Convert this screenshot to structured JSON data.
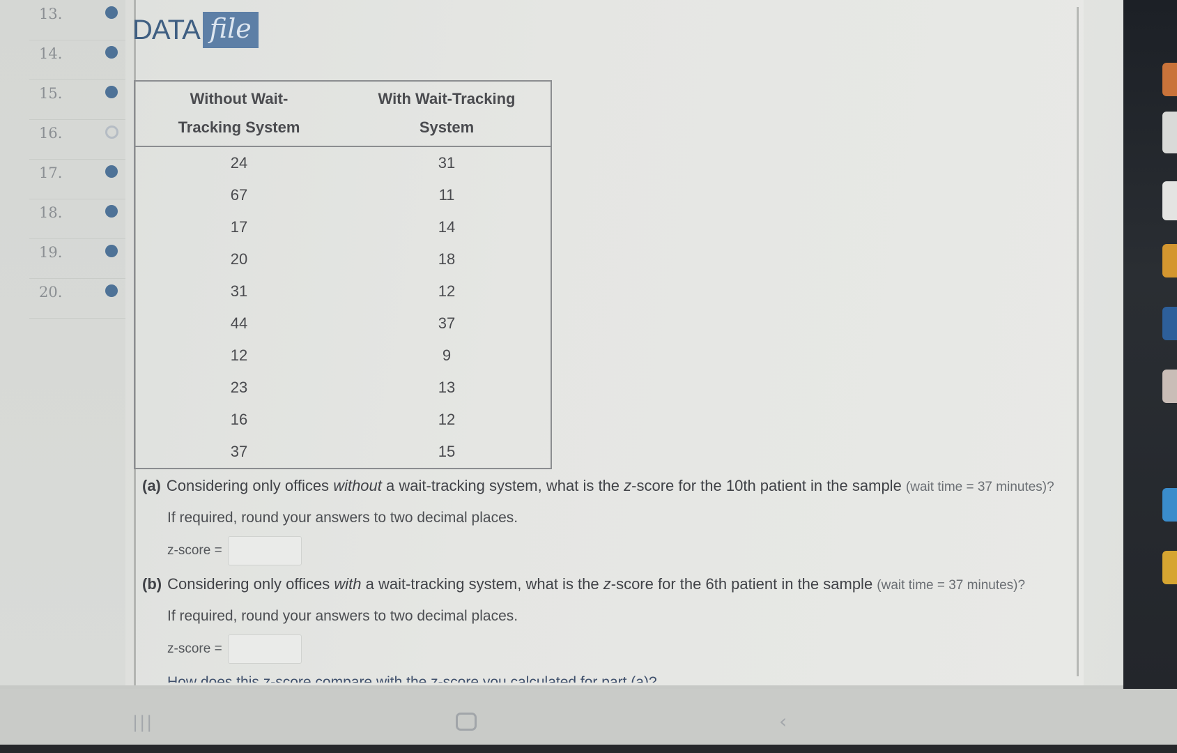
{
  "sidebar": {
    "items": [
      {
        "number": "13.",
        "status": "answered"
      },
      {
        "number": "14.",
        "status": "answered"
      },
      {
        "number": "15.",
        "status": "answered"
      },
      {
        "number": "16.",
        "status": "unanswered"
      },
      {
        "number": "17.",
        "status": "answered"
      },
      {
        "number": "18.",
        "status": "answered"
      },
      {
        "number": "19.",
        "status": "answered"
      },
      {
        "number": "20.",
        "status": "answered"
      }
    ]
  },
  "data_badge": {
    "data_text": "DATA",
    "file_text": "file"
  },
  "table": {
    "headers": [
      [
        "Without Wait-",
        "Tracking System"
      ],
      [
        "With Wait-Tracking",
        "System"
      ]
    ],
    "rows": [
      [
        "24",
        "31"
      ],
      [
        "67",
        "11"
      ],
      [
        "17",
        "14"
      ],
      [
        "20",
        "18"
      ],
      [
        "31",
        "12"
      ],
      [
        "44",
        "37"
      ],
      [
        "12",
        "9"
      ],
      [
        "23",
        "13"
      ],
      [
        "16",
        "12"
      ],
      [
        "37",
        "15"
      ]
    ]
  },
  "part_a": {
    "label": "(a)",
    "text_before": "Considering only offices ",
    "emphasis": "without",
    "text_mid": " a wait-tracking system, what is the ",
    "zvar": "z",
    "text_after": "-score for the 10th patient in the sample ",
    "paren": "(wait time = 37 minutes)?",
    "hint": "If required, round your answers to two decimal places.",
    "z_label": "z-score =",
    "z_value": ""
  },
  "part_b": {
    "label": "(b)",
    "text_before": "Considering only offices ",
    "emphasis": "with",
    "text_mid": " a wait-tracking system, what is the ",
    "zvar": "z",
    "text_after": "-score for the 6th patient in the sample ",
    "paren": "(wait time = 37 minutes)?",
    "hint": "If required, round your answers to two decimal places.",
    "z_label": "z-score =",
    "z_value": ""
  },
  "followup": {
    "text": "How does this z-score compare with the z-score you calculated for part (a)?"
  },
  "colors": {
    "accent_blue": "#4e7297",
    "badge_blue": "#5d7fa6",
    "data_text": "#3f5f82"
  }
}
